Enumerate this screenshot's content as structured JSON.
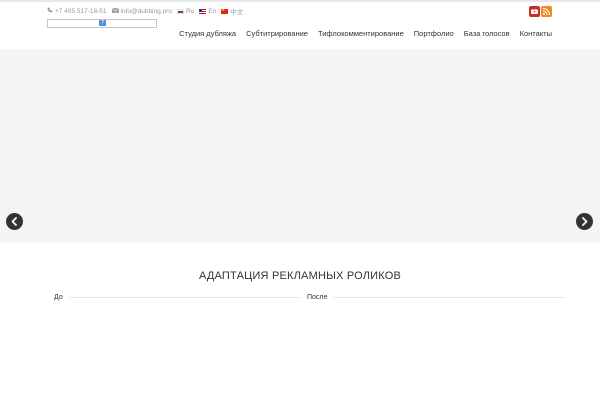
{
  "topbar": {
    "phone": "+7 495 517-18-51",
    "email": "info@dubbing.pro",
    "languages": [
      {
        "label": "Ru",
        "flag": "ru-flag-icon"
      },
      {
        "label": "En",
        "flag": "us-flag-icon"
      },
      {
        "label": "中文",
        "flag": "cn-flag-icon"
      }
    ],
    "social": [
      {
        "name": "youtube-icon",
        "color": "#c4302b"
      },
      {
        "name": "rss-icon",
        "color": "#f08a24"
      }
    ]
  },
  "logo": {
    "text": "?"
  },
  "nav": {
    "items": [
      {
        "label": "Студия дубляжа"
      },
      {
        "label": "Субтитрирование"
      },
      {
        "label": "Тифлокомментирование"
      },
      {
        "label": "Портфолио"
      },
      {
        "label": "База голосов"
      },
      {
        "label": "Контакты"
      }
    ]
  },
  "colors": {
    "accent_text": "#333333",
    "muted": "#9a9a9a",
    "hero_bg": "#f5f5f5"
  },
  "section": {
    "title": "АДАПТАЦИЯ РЕКЛАМНЫХ РОЛИКОВ",
    "before_label": "До",
    "after_label": "После"
  }
}
